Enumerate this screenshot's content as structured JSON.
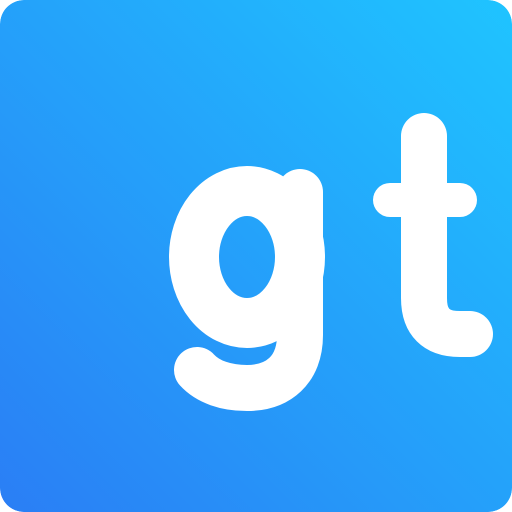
{
  "icon": {
    "name": "gt-app-icon",
    "lettering": "gt",
    "colors": {
      "gradient_start": "#1fc4ff",
      "gradient_end": "#2a7ef5",
      "letter": "#ffffff"
    }
  }
}
